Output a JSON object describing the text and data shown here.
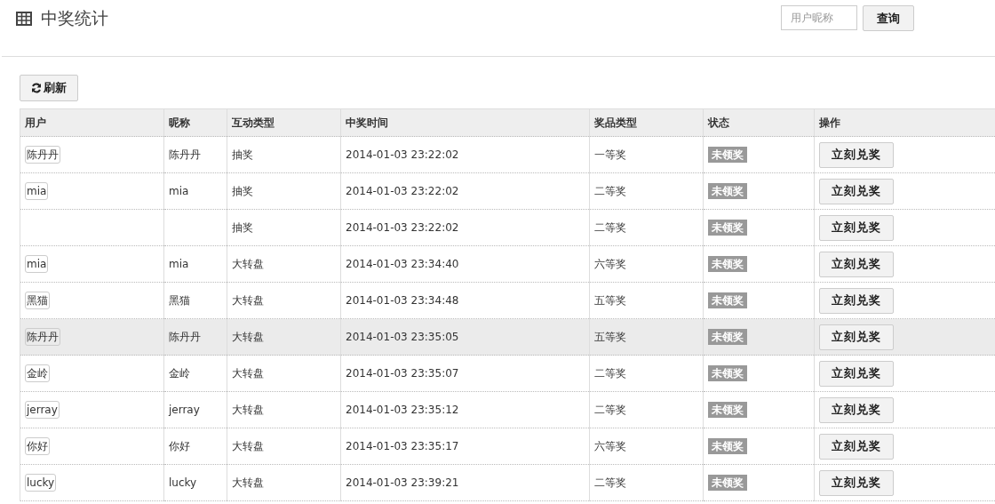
{
  "page_title": "中奖统计",
  "search": {
    "placeholder": "用户昵称",
    "button": "查询"
  },
  "refresh_button": "刷新",
  "table": {
    "columns": [
      "用户",
      "昵称",
      "互动类型",
      "中奖时间",
      "奖品类型",
      "状态",
      "操作"
    ],
    "rows": [
      {
        "user": "陈丹丹",
        "nickname": "陈丹丹",
        "type": "抽奖",
        "time": "2014-01-03 23:22:02",
        "prize": "一等奖",
        "status": "未领奖",
        "action": "立刻兑奖",
        "hovered": false
      },
      {
        "user": "mia",
        "nickname": "mia",
        "type": "抽奖",
        "time": "2014-01-03 23:22:02",
        "prize": "二等奖",
        "status": "未领奖",
        "action": "立刻兑奖",
        "hovered": false
      },
      {
        "type": "抽奖",
        "time": "2014-01-03 23:22:02",
        "prize": "二等奖",
        "status": "未领奖",
        "action": "立刻兑奖",
        "hovered": false
      },
      {
        "user": "mia",
        "nickname": "mia",
        "type": "大转盘",
        "time": "2014-01-03 23:34:40",
        "prize": "六等奖",
        "status": "未领奖",
        "action": "立刻兑奖",
        "hovered": false
      },
      {
        "user": "黑猫",
        "nickname": "黑猫",
        "type": "大转盘",
        "time": "2014-01-03 23:34:48",
        "prize": "五等奖",
        "status": "未领奖",
        "action": "立刻兑奖",
        "hovered": false
      },
      {
        "user": "陈丹丹",
        "nickname": "陈丹丹",
        "type": "大转盘",
        "time": "2014-01-03 23:35:05",
        "prize": "五等奖",
        "status": "未领奖",
        "action": "立刻兑奖",
        "hovered": true
      },
      {
        "user": "金岭",
        "nickname": "金岭",
        "type": "大转盘",
        "time": "2014-01-03 23:35:07",
        "prize": "二等奖",
        "status": "未领奖",
        "action": "立刻兑奖",
        "hovered": false
      },
      {
        "user": "jerray",
        "nickname": "jerray",
        "type": "大转盘",
        "time": "2014-01-03 23:35:12",
        "prize": "二等奖",
        "status": "未领奖",
        "action": "立刻兑奖",
        "hovered": false
      },
      {
        "user": "你好",
        "nickname": "你好",
        "type": "大转盘",
        "time": "2014-01-03 23:35:17",
        "prize": "六等奖",
        "status": "未领奖",
        "action": "立刻兑奖",
        "hovered": false
      },
      {
        "user": "lucky",
        "nickname": "lucky",
        "type": "大转盘",
        "time": "2014-01-03 23:39:21",
        "prize": "二等奖",
        "status": "未领奖",
        "action": "立刻兑奖",
        "hovered": false
      }
    ]
  }
}
